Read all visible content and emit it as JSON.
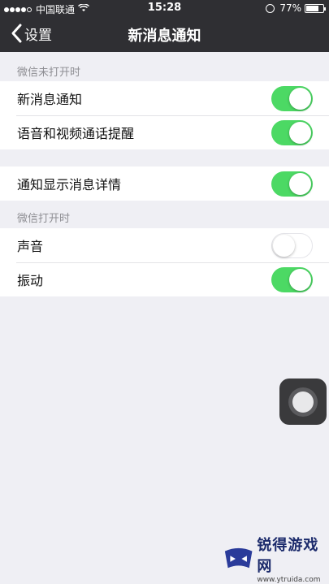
{
  "status_bar": {
    "carrier": "中国联通",
    "time": "15:28",
    "battery_percent": "77%",
    "battery_level": 0.77
  },
  "nav": {
    "back_label": "设置",
    "title": "新消息通知"
  },
  "sections": {
    "wechat_closed": "微信未打开时",
    "wechat_open": "微信打开时"
  },
  "settings": {
    "new_message_notify": {
      "label": "新消息通知",
      "on": true
    },
    "voice_video_alert": {
      "label": "语音和视频通话提醒",
      "on": true
    },
    "show_message_detail": {
      "label": "通知显示消息详情",
      "on": true
    },
    "sound": {
      "label": "声音",
      "on": false
    },
    "vibrate": {
      "label": "振动",
      "on": true
    }
  },
  "colors": {
    "nav_bg": "#2f2f33",
    "switch_on": "#4cd964",
    "page_bg": "#efeff4"
  },
  "watermark": {
    "title": "锐得游戏网",
    "url": "www.ytruida.com"
  }
}
